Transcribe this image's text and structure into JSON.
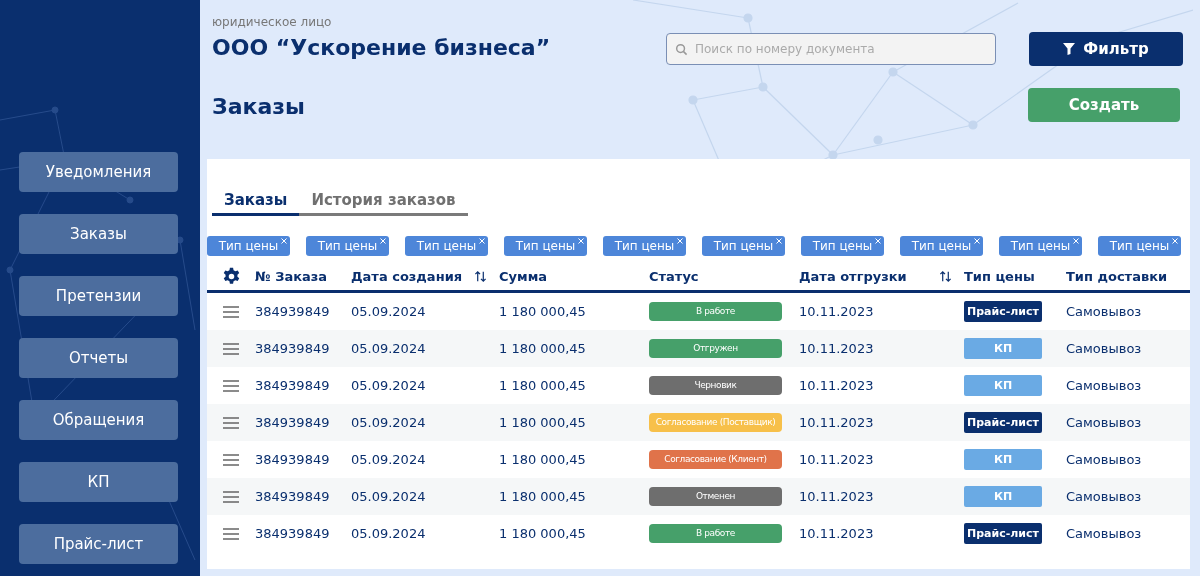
{
  "sidebar": {
    "items": [
      {
        "label": "Уведомления",
        "selected": false
      },
      {
        "label": "Заказы",
        "selected": false
      },
      {
        "label": "Претензии",
        "selected": false
      },
      {
        "label": "Отчеты",
        "selected": false
      },
      {
        "label": "Обращения",
        "selected": false
      },
      {
        "label": "КП",
        "selected": false
      },
      {
        "label": "Прайс-лист",
        "selected": false
      }
    ]
  },
  "header": {
    "entity_type": "юридическое лицо",
    "company": "ООО “Ускорение бизнеса”",
    "search": {
      "placeholder": "Поиск по номеру документа"
    },
    "filter_button": "Фильтр"
  },
  "page_title": "Заказы",
  "create_button": "Создать",
  "tabs": [
    {
      "label": "Заказы",
      "selected": true
    },
    {
      "label": "История заказов",
      "selected": false
    }
  ],
  "filter_chips": [
    "Тип цены",
    "Тип цены",
    "Тип цены",
    "Тип цены",
    "Тип цены",
    "Тип цены",
    "Тип цены",
    "Тип цены",
    "Тип цены",
    "Тип цены"
  ],
  "table": {
    "columns": [
      {
        "label": "№ Заказа",
        "sortable": false
      },
      {
        "label": "Дата создания",
        "sortable": true
      },
      {
        "label": "Сумма",
        "sortable": false
      },
      {
        "label": "Статус",
        "sortable": false
      },
      {
        "label": "Дата отгрузки",
        "sortable": true
      },
      {
        "label": "Тип цены",
        "sortable": false
      },
      {
        "label": "Тип доставки",
        "sortable": false
      }
    ],
    "rows": [
      {
        "number": "384939849",
        "created": "05.09.2024",
        "sum": "1 180 000,45",
        "status": {
          "label": "В работе",
          "color": "#46a06a"
        },
        "shipped": "10.11.2023",
        "price_type": {
          "label": "Прайс-лист",
          "kind": "price_list"
        },
        "delivery": "Самовывоз"
      },
      {
        "number": "384939849",
        "created": "05.09.2024",
        "sum": "1 180 000,45",
        "status": {
          "label": "Отгружен",
          "color": "#46a06a"
        },
        "shipped": "10.11.2023",
        "price_type": {
          "label": "КП",
          "kind": "kp"
        },
        "delivery": "Самовывоз"
      },
      {
        "number": "384939849",
        "created": "05.09.2024",
        "sum": "1 180 000,45",
        "status": {
          "label": "Черновик",
          "color": "#6e6e6e"
        },
        "shipped": "10.11.2023",
        "price_type": {
          "label": "КП",
          "kind": "kp"
        },
        "delivery": "Самовывоз"
      },
      {
        "number": "384939849",
        "created": "05.09.2024",
        "sum": "1 180 000,45",
        "status": {
          "label": "Согласование (Поставщик)",
          "color": "#f7c04a"
        },
        "shipped": "10.11.2023",
        "price_type": {
          "label": "Прайс-лист",
          "kind": "price_list"
        },
        "delivery": "Самовывоз"
      },
      {
        "number": "384939849",
        "created": "05.09.2024",
        "sum": "1 180 000,45",
        "status": {
          "label": "Согласование (Клиент)",
          "color": "#e0734a"
        },
        "shipped": "10.11.2023",
        "price_type": {
          "label": "КП",
          "kind": "kp"
        },
        "delivery": "Самовывоз"
      },
      {
        "number": "384939849",
        "created": "05.09.2024",
        "sum": "1 180 000,45",
        "status": {
          "label": "Отменен",
          "color": "#6e6e6e"
        },
        "shipped": "10.11.2023",
        "price_type": {
          "label": "КП",
          "kind": "kp"
        },
        "delivery": "Самовывоз"
      },
      {
        "number": "384939849",
        "created": "05.09.2024",
        "sum": "1 180 000,45",
        "status": {
          "label": "В работе",
          "color": "#46a06a"
        },
        "shipped": "10.11.2023",
        "price_type": {
          "label": "Прайс-лист",
          "kind": "price_list"
        },
        "delivery": "Самовывоз"
      }
    ]
  }
}
